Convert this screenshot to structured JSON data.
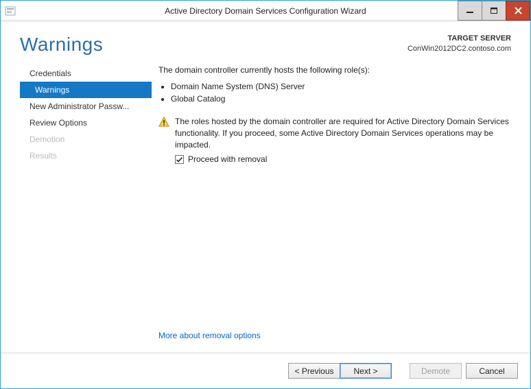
{
  "window": {
    "title": "Active Directory Domain Services Configuration Wizard"
  },
  "header": {
    "page_title": "Warnings",
    "target_label": "TARGET SERVER",
    "target_value": "ConWin2012DC2.contoso.com"
  },
  "sidebar": {
    "items": [
      {
        "label": "Credentials",
        "selected": false,
        "disabled": false
      },
      {
        "label": "Warnings",
        "selected": true,
        "disabled": false
      },
      {
        "label": "New Administrator Passw...",
        "selected": false,
        "disabled": false
      },
      {
        "label": "Review Options",
        "selected": false,
        "disabled": false
      },
      {
        "label": "Demotion",
        "selected": false,
        "disabled": true
      },
      {
        "label": "Results",
        "selected": false,
        "disabled": true
      }
    ]
  },
  "main": {
    "intro": "The domain controller currently hosts the following role(s):",
    "roles": [
      "Domain Name System (DNS) Server",
      "Global Catalog"
    ],
    "warning": "The roles hosted by the domain controller are required for Active Directory Domain Services functionality. If you proceed, some Active Directory Domain Services operations may be impacted.",
    "proceed_label": "Proceed with removal",
    "proceed_checked": true,
    "more_link": "More about removal options"
  },
  "footer": {
    "previous": "< Previous",
    "next": "Next >",
    "demote": "Demote",
    "cancel": "Cancel"
  }
}
